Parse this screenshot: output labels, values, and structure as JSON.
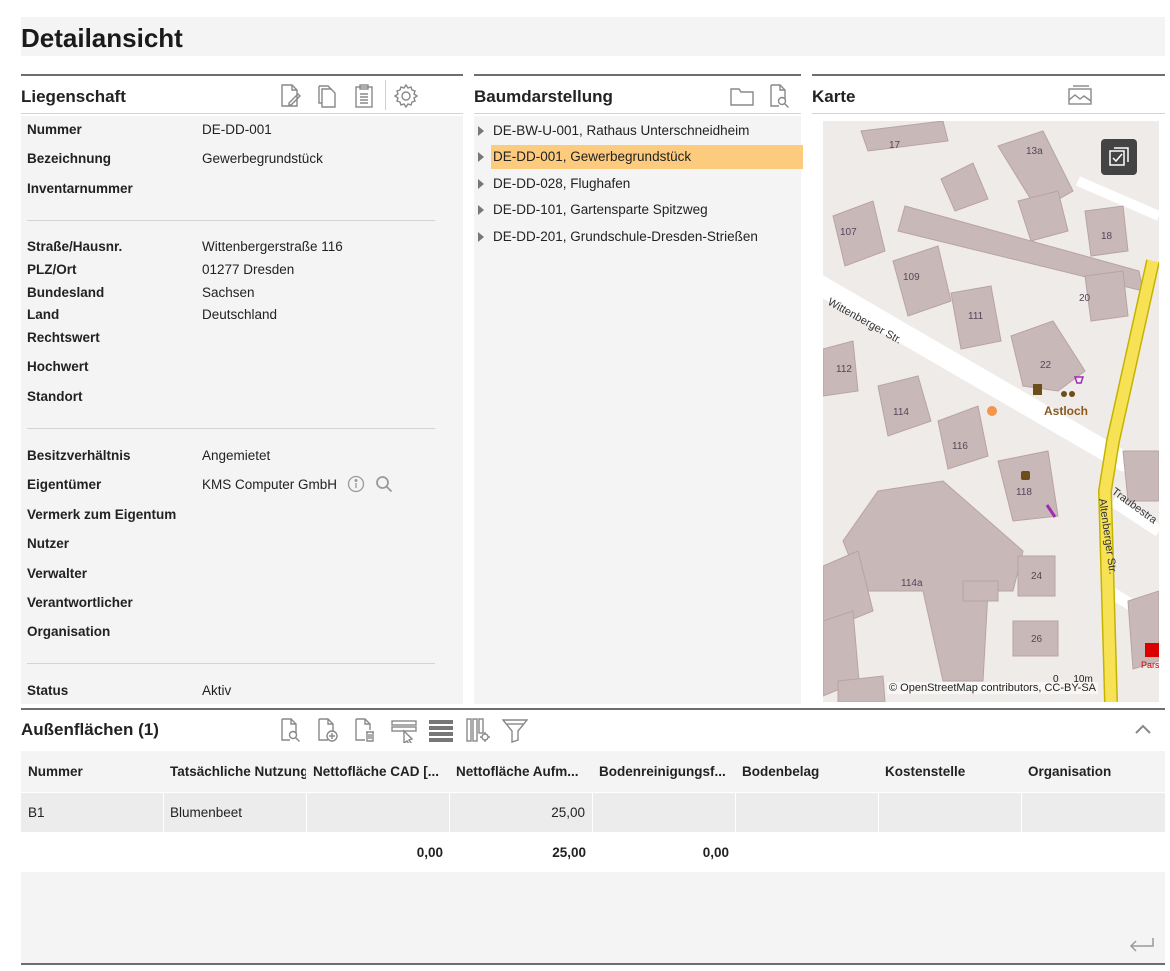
{
  "page": {
    "title": "Detailansicht"
  },
  "property": {
    "title": "Liegenschaft",
    "rows": [
      {
        "label": "Nummer",
        "value": "DE-DD-001"
      },
      {
        "label": "Bezeichnung",
        "value": "Gewerbegrundstück"
      },
      {
        "label": "Inventarnummer",
        "value": ""
      },
      {
        "label": "Straße/Hausnr.",
        "value": "Wittenbergerstraße 116"
      },
      {
        "label": "PLZ/Ort",
        "value": "01277 Dresden"
      },
      {
        "label": "Bundesland",
        "value": "Sachsen"
      },
      {
        "label": "Land",
        "value": "Deutschland"
      },
      {
        "label": "Rechtswert",
        "value": ""
      },
      {
        "label": "Hochwert",
        "value": ""
      },
      {
        "label": "Standort",
        "value": ""
      },
      {
        "label": "Besitzverhältnis",
        "value": "Angemietet"
      },
      {
        "label": "Eigentümer",
        "value": "KMS Computer GmbH"
      },
      {
        "label": "Vermerk zum Eigentum",
        "value": ""
      },
      {
        "label": "Nutzer",
        "value": ""
      },
      {
        "label": "Verwalter",
        "value": ""
      },
      {
        "label": "Verantwortlicher",
        "value": ""
      },
      {
        "label": "Organisation",
        "value": ""
      },
      {
        "label": "Status",
        "value": "Aktiv"
      }
    ]
  },
  "tree": {
    "title": "Baumdarstellung",
    "items": [
      {
        "label": "DE-BW-U-001, Rathaus Unterschneidheim",
        "selected": false
      },
      {
        "label": "DE-DD-001, Gewerbegrundstück",
        "selected": true
      },
      {
        "label": "DE-DD-028, Flughafen",
        "selected": false
      },
      {
        "label": "DE-DD-101, Gartensparte Spitzweg",
        "selected": false
      },
      {
        "label": "DE-DD-201, Grundschule-Dresden-Strießen",
        "selected": false
      }
    ]
  },
  "map": {
    "title": "Karte",
    "attribution": "© OpenStreetMap contributors, CC-BY-SA",
    "scale": "10m",
    "scale_zero": "0",
    "labels": {
      "street1": "Wittenberger Str.",
      "street2": "Altenberger Str.",
      "street3": "Traubestra",
      "poi": "Astloch",
      "pharmacy": "Pars Apoth"
    },
    "house_numbers": [
      "17",
      "13a",
      "107",
      "18",
      "109",
      "20",
      "111",
      "112",
      "22",
      "114",
      "116",
      "118",
      "114a",
      "24",
      "26"
    ]
  },
  "outdoor": {
    "title": "Außenflächen (1)",
    "columns": [
      "Nummer",
      "Tatsächliche Nutzung",
      "Nettofläche CAD [...",
      "Nettofläche Aufm...",
      "Bodenreinigungsf...",
      "Bodenbelag",
      "Kostenstelle",
      "Organisation"
    ],
    "rows": [
      [
        "B1",
        "Blumenbeet",
        "",
        "25,00",
        "",
        "",
        "",
        ""
      ]
    ],
    "sums": [
      "0,00",
      "25,00",
      "0,00"
    ]
  },
  "colors": {
    "selected_row": "#fdcb7e",
    "road_yellow": "#f7e255",
    "building": "#c9b8b8"
  }
}
